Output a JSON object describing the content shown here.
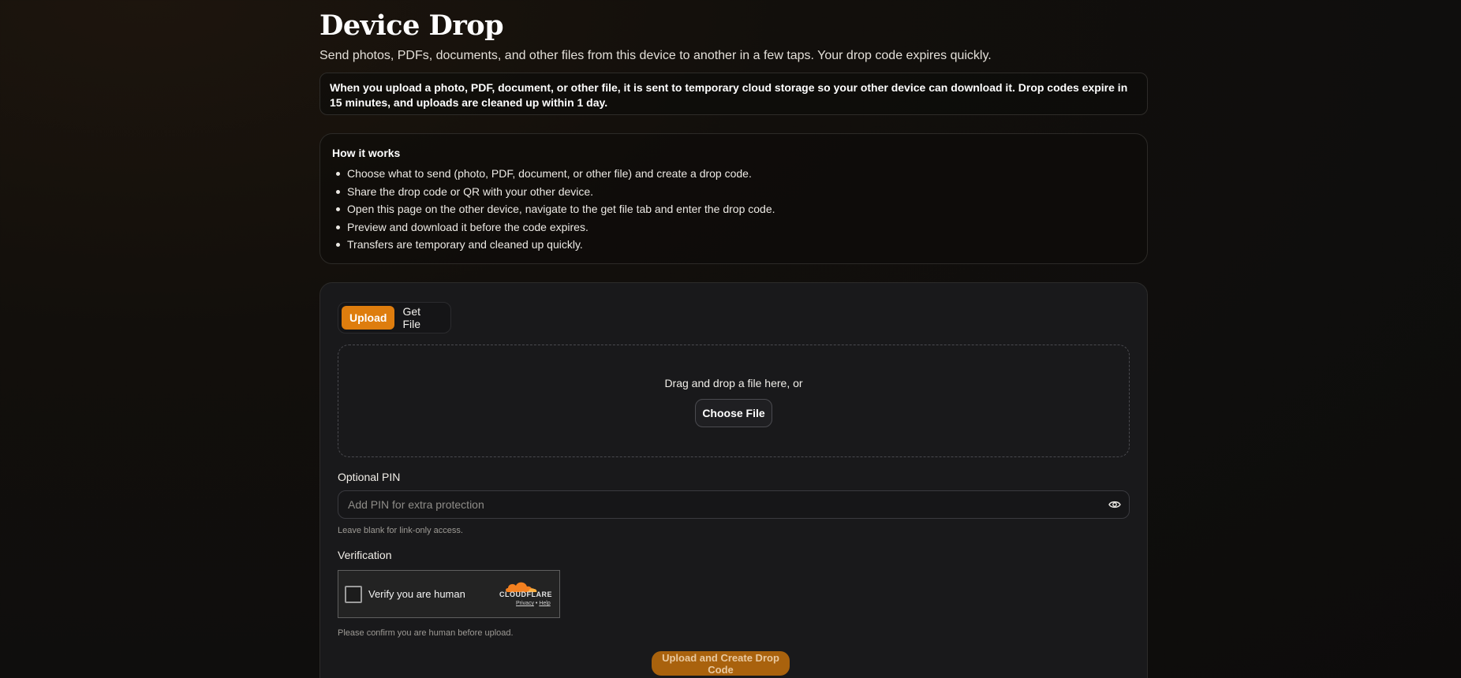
{
  "header": {
    "title": "Device Drop",
    "subtitle": "Send photos, PDFs, documents, and other files from this device to another in a few taps. Your drop code expires quickly."
  },
  "notice": {
    "text": "When you upload a photo, PDF, document, or other file, it is sent to temporary cloud storage so your other device can download it. Drop codes expire in 15 minutes, and uploads are cleaned up within 1 day."
  },
  "how_it_works": {
    "title": "How it works",
    "items": [
      "Choose what to send (photo, PDF, document, or other file) and create a drop code.",
      "Share the drop code or QR with your other device.",
      "Open this page on the other device, navigate to the get file tab and enter the drop code.",
      "Preview and download it before the code expires.",
      "Transfers are temporary and cleaned up quickly."
    ]
  },
  "tabs": [
    {
      "label": "Upload",
      "active": true
    },
    {
      "label": "Get File",
      "active": false
    }
  ],
  "dropzone": {
    "text": "Drag and drop a file here, or",
    "button_label": "Choose File"
  },
  "pin": {
    "label": "Optional PIN",
    "placeholder": "Add PIN for extra protection",
    "value": "",
    "help": "Leave blank for link-only access."
  },
  "verification": {
    "label": "Verification",
    "captcha_text": "Verify you are human",
    "provider": "CLOUDFLARE",
    "privacy_link": "Privacy",
    "separator": "•",
    "help_link": "Help",
    "help": "Please confirm you are human before upload."
  },
  "submit": {
    "label": "Upload and Create Drop Code"
  },
  "colors": {
    "accent": "#de7d0e",
    "submit_bg": "#a9620d",
    "card_bg": "#19191b"
  }
}
